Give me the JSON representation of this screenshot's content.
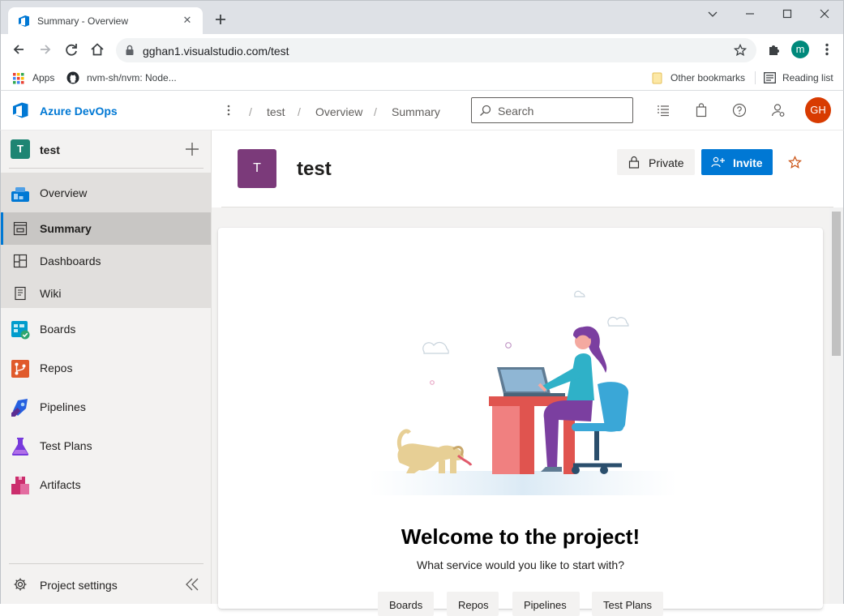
{
  "browser": {
    "tab_title": "Summary - Overview",
    "url": "gghan1.visualstudio.com/test",
    "profile_initial": "m",
    "bookmarks": [
      "Apps",
      "nvm-sh/nvm: Node..."
    ],
    "bookmarks_right": [
      "Other bookmarks",
      "Reading list"
    ]
  },
  "ado": {
    "brand": "Azure DevOps",
    "breadcrumbs": [
      "test",
      "Overview",
      "Summary"
    ],
    "search_placeholder": "Search",
    "user_initials": "GH"
  },
  "sidebar": {
    "project_initial": "T",
    "project_name": "test",
    "items": [
      {
        "label": "Overview",
        "icon": "overview-icon"
      },
      {
        "label": "Summary",
        "icon": "summary-icon",
        "selected": true
      },
      {
        "label": "Dashboards",
        "icon": "dashboards-icon"
      },
      {
        "label": "Wiki",
        "icon": "wiki-icon"
      },
      {
        "label": "Boards",
        "icon": "boards-icon"
      },
      {
        "label": "Repos",
        "icon": "repos-icon"
      },
      {
        "label": "Pipelines",
        "icon": "pipelines-icon"
      },
      {
        "label": "Test Plans",
        "icon": "test-plans-icon"
      },
      {
        "label": "Artifacts",
        "icon": "artifacts-icon"
      }
    ],
    "settings_label": "Project settings"
  },
  "main": {
    "project_initial": "T",
    "project_title": "test",
    "private_label": "Private",
    "invite_label": "Invite",
    "welcome_title": "Welcome to the project!",
    "welcome_subtitle": "What service would you like to start with?",
    "service_buttons": [
      "Boards",
      "Repos",
      "Pipelines",
      "Test Plans"
    ]
  },
  "colors": {
    "accent": "#0078d4",
    "project_tile": "#1e8573",
    "project_big_tile": "#7b3a7a",
    "user_avatar": "#d83b01"
  }
}
